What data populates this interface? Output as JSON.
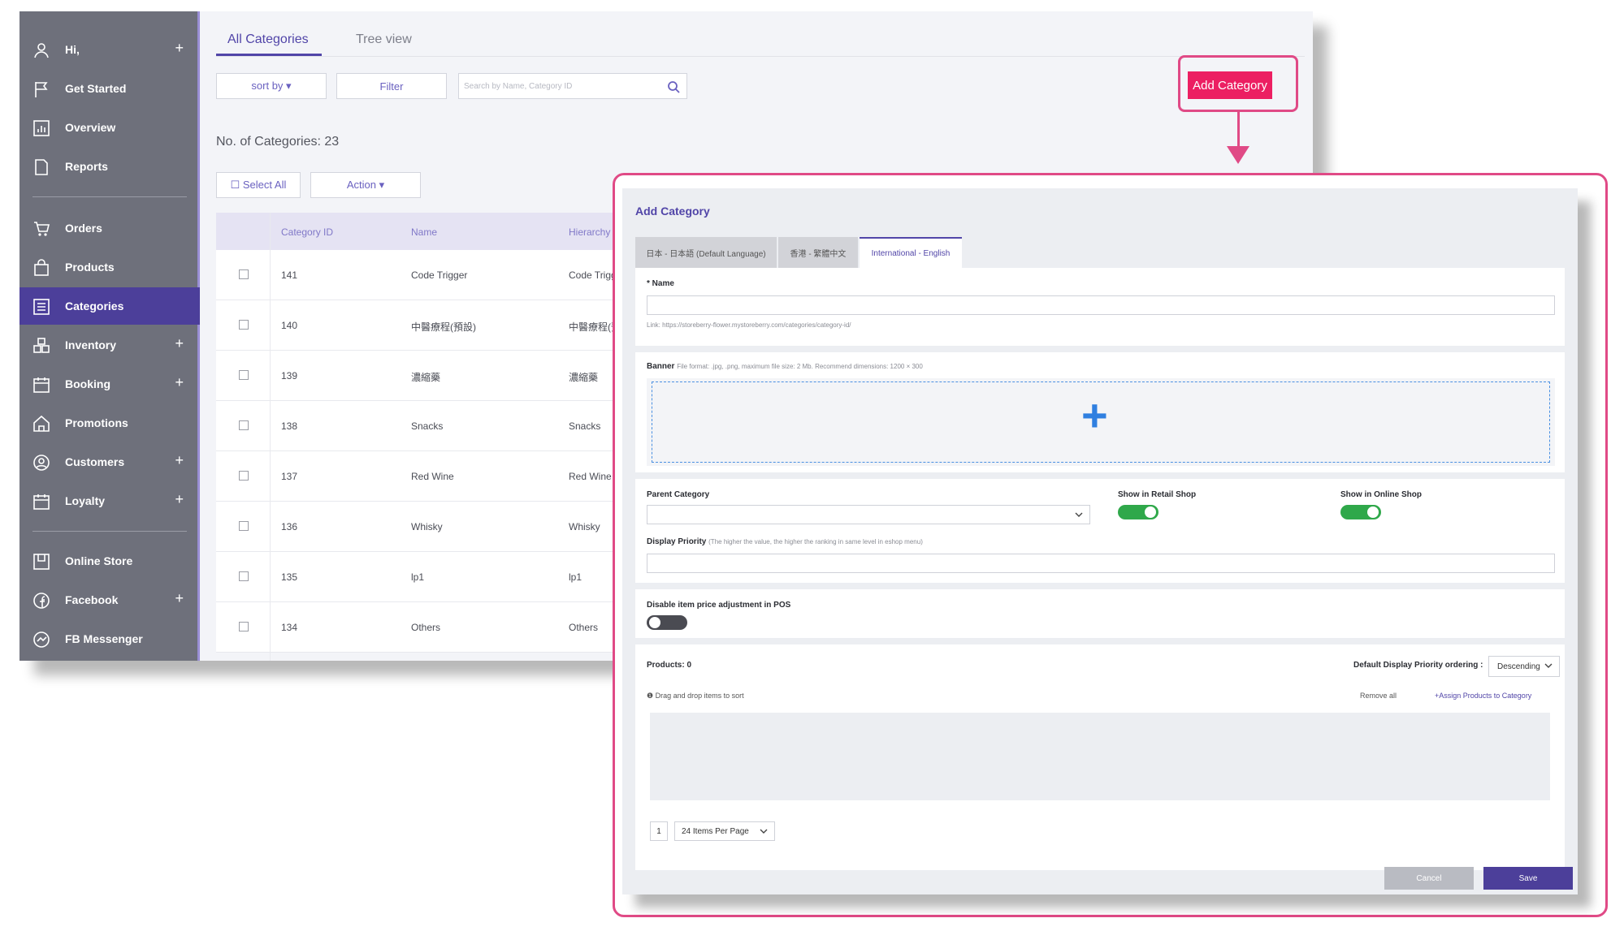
{
  "sidebar": {
    "items": [
      {
        "label": "Hi,",
        "icon": "user-icon",
        "plus": "+"
      },
      {
        "label": "Get Started",
        "icon": "flag-icon",
        "plus": ""
      },
      {
        "label": "Overview",
        "icon": "chart-icon",
        "plus": ""
      },
      {
        "label": "Reports",
        "icon": "document-icon",
        "plus": ""
      },
      {
        "label": "Orders",
        "icon": "cart-icon",
        "plus": ""
      },
      {
        "label": "Products",
        "icon": "bag-icon",
        "plus": ""
      },
      {
        "label": "Categories",
        "icon": "list-icon",
        "plus": ""
      },
      {
        "label": "Inventory",
        "icon": "boxes-icon",
        "plus": "+"
      },
      {
        "label": "Booking",
        "icon": "calendar-icon",
        "plus": "+"
      },
      {
        "label": "Promotions",
        "icon": "tag-home-icon",
        "plus": ""
      },
      {
        "label": "Customers",
        "icon": "customer-icon",
        "plus": "+"
      },
      {
        "label": "Loyalty",
        "icon": "calendar-icon",
        "plus": "+"
      },
      {
        "label": "Online Store",
        "icon": "store-icon",
        "plus": ""
      },
      {
        "label": "Facebook",
        "icon": "facebook-icon",
        "plus": "+"
      },
      {
        "label": "FB Messenger",
        "icon": "messenger-icon",
        "plus": ""
      }
    ]
  },
  "tabs": {
    "all": "All Categories",
    "tree": "Tree view"
  },
  "toolbar": {
    "sort_label": "sort by ▾",
    "filter_label": "Filter",
    "search_placeholder": "Search by Name, Category ID",
    "add_label": "Add Category"
  },
  "count_label": "No. of Categories: 23",
  "bulk": {
    "select_all": "☐ Select All",
    "action": "Action ▾"
  },
  "table": {
    "headers": {
      "id": "Category ID",
      "name": "Name",
      "hierarchy": "Hierarchy"
    },
    "rows": [
      {
        "id": "141",
        "name": "Code Trigger",
        "hierarchy": "Code Trigge"
      },
      {
        "id": "140",
        "name": "中醫療程(預設)",
        "hierarchy": "中醫療程(預"
      },
      {
        "id": "139",
        "name": "濃縮藥",
        "hierarchy": "濃縮藥"
      },
      {
        "id": "138",
        "name": "Snacks",
        "hierarchy": "Snacks"
      },
      {
        "id": "137",
        "name": "Red Wine",
        "hierarchy": "Red Wine"
      },
      {
        "id": "136",
        "name": "Whisky",
        "hierarchy": "Whisky"
      },
      {
        "id": "135",
        "name": "lp1",
        "hierarchy": "lp1"
      },
      {
        "id": "134",
        "name": "Others",
        "hierarchy": "Others"
      }
    ]
  },
  "dialog": {
    "title": "Add Category",
    "lang_tabs": [
      "日本 - 日本語 (Default Language)",
      "香港 - 繁體中文",
      "International - English"
    ],
    "name_label": "* Name",
    "link_hint": "Link: https://storeberry-flower.mystoreberry.com/categories/category-id/",
    "banner_label": "Banner",
    "banner_hint": "File format: .jpg, .png, maximum file size: 2 Mb. Recommend dimensions: 1200 × 300",
    "banner_plus": "+",
    "parent_label": "Parent Category",
    "retail_label": "Show in Retail Shop",
    "online_label": "Show in Online Shop",
    "priority_label": "Display Priority",
    "priority_hint": "(The higher the value, the higher the ranking in same level in eshop menu)",
    "disable_label": "Disable item price adjustment in POS",
    "products_label": "Products: 0",
    "ordering_label": "Default Display Priority ordering :",
    "ordering_value": "Descending",
    "drag_hint": "❶ Drag and drop items to sort",
    "remove_all": "Remove all",
    "assign": "+Assign Products to Category",
    "page_number": "1",
    "per_page": "24 Items Per Page",
    "cancel": "Cancel",
    "save": "Save",
    "retail_on": true,
    "online_on": true,
    "disable_on": false
  },
  "colors": {
    "brand_purple": "#5145a8",
    "accent_pink": "#ec1f62",
    "highlight": "#e04a86",
    "toggle_on": "#2fa84a",
    "sidebar_bg": "#6e707b"
  }
}
